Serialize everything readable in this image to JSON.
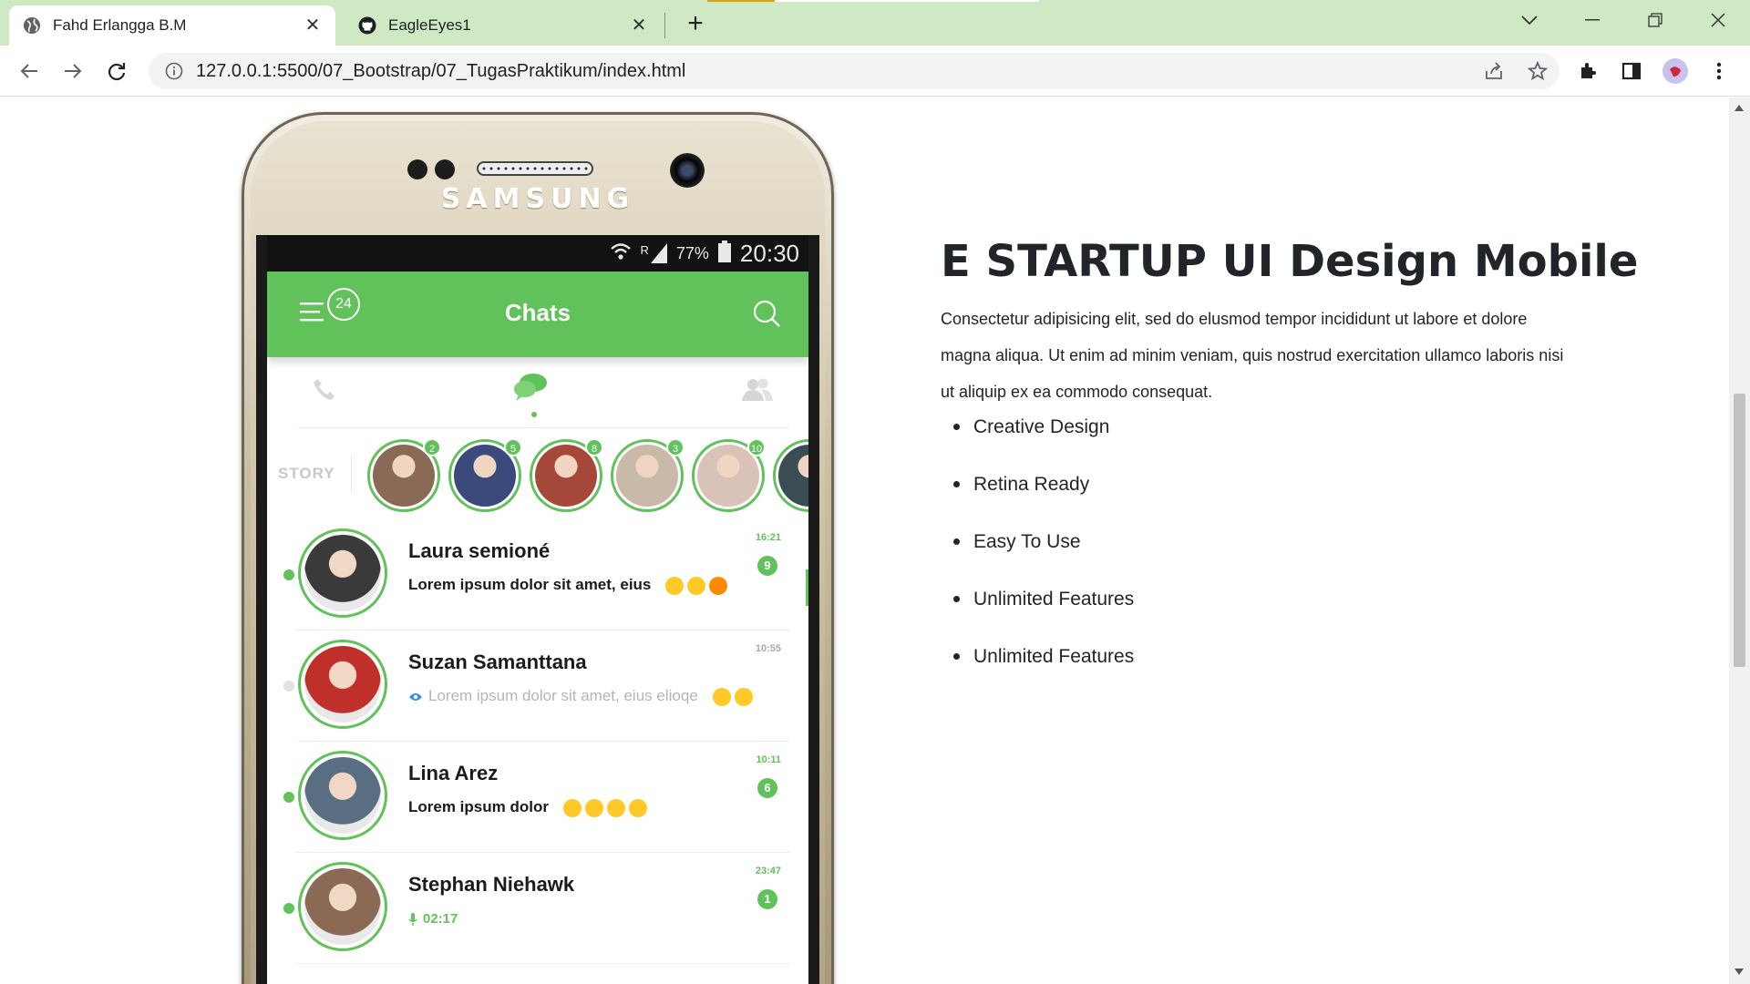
{
  "browser": {
    "tabs": [
      {
        "title": "Fahd Erlangga B.M",
        "icon": "globe-icon",
        "active": true
      },
      {
        "title": "EagleEyes1",
        "icon": "github-icon",
        "active": false
      }
    ],
    "url": "127.0.0.1:5500/07_Bootstrap/07_TugasPraktikum/index.html"
  },
  "phone": {
    "brand": "SAMSUNG",
    "status": {
      "battery": "77%",
      "signal_label": "R",
      "time": "20:30"
    },
    "app_title": "Chats",
    "menu_badge": "24",
    "stories_label": "STORY",
    "stories": [
      {
        "count": "2",
        "color": "#8a6a55"
      },
      {
        "count": "5",
        "color": "#3b4a7a"
      },
      {
        "count": "8",
        "color": "#a5483a"
      },
      {
        "count": "3",
        "color": "#c9b9a8"
      },
      {
        "count": "10",
        "color": "#d9c2b8"
      },
      {
        "count": "",
        "color": "#3a4d55"
      }
    ],
    "chats": [
      {
        "name": "Laura semioné",
        "message": "Lorem ipsum dolor sit amet, eius",
        "time": "16:21",
        "unread": "9",
        "read": false,
        "online": true,
        "emojis": 3,
        "color": "#3a3a3a"
      },
      {
        "name": "Suzan Samanttana",
        "message": "Lorem ipsum dolor sit amet, eius elioqe",
        "time": "10:55",
        "unread": "",
        "read": true,
        "online": false,
        "emojis": 2,
        "color": "#c0302a"
      },
      {
        "name": "Lina Arez",
        "message": "Lorem ipsum dolor",
        "time": "10:11",
        "unread": "6",
        "read": false,
        "online": true,
        "emojis": 4,
        "color": "#5a6e82"
      },
      {
        "name": "Stephan Niehawk",
        "message": "02:17",
        "time": "23:47",
        "unread": "1",
        "read": false,
        "online": true,
        "emojis": 0,
        "color": "#8a6a55"
      }
    ]
  },
  "content": {
    "heading_bold": "E STARTUP",
    "heading_rest": " UI Design Mobile",
    "lead": "Consectetur adipisicing elit, sed do elusmod tempor incididunt ut labore et dolore magna aliqua. Ut enim ad minim veniam, quis nostrud exercitation ullamco laboris nisi ut aliquip ex ea commodo consequat.",
    "features": [
      "Creative Design",
      "Retina Ready",
      "Easy To Use",
      "Unlimited Features",
      "Unlimited Features"
    ]
  },
  "colors": {
    "accent": "#61c15a",
    "tabstrip": "#cfe9c5"
  }
}
